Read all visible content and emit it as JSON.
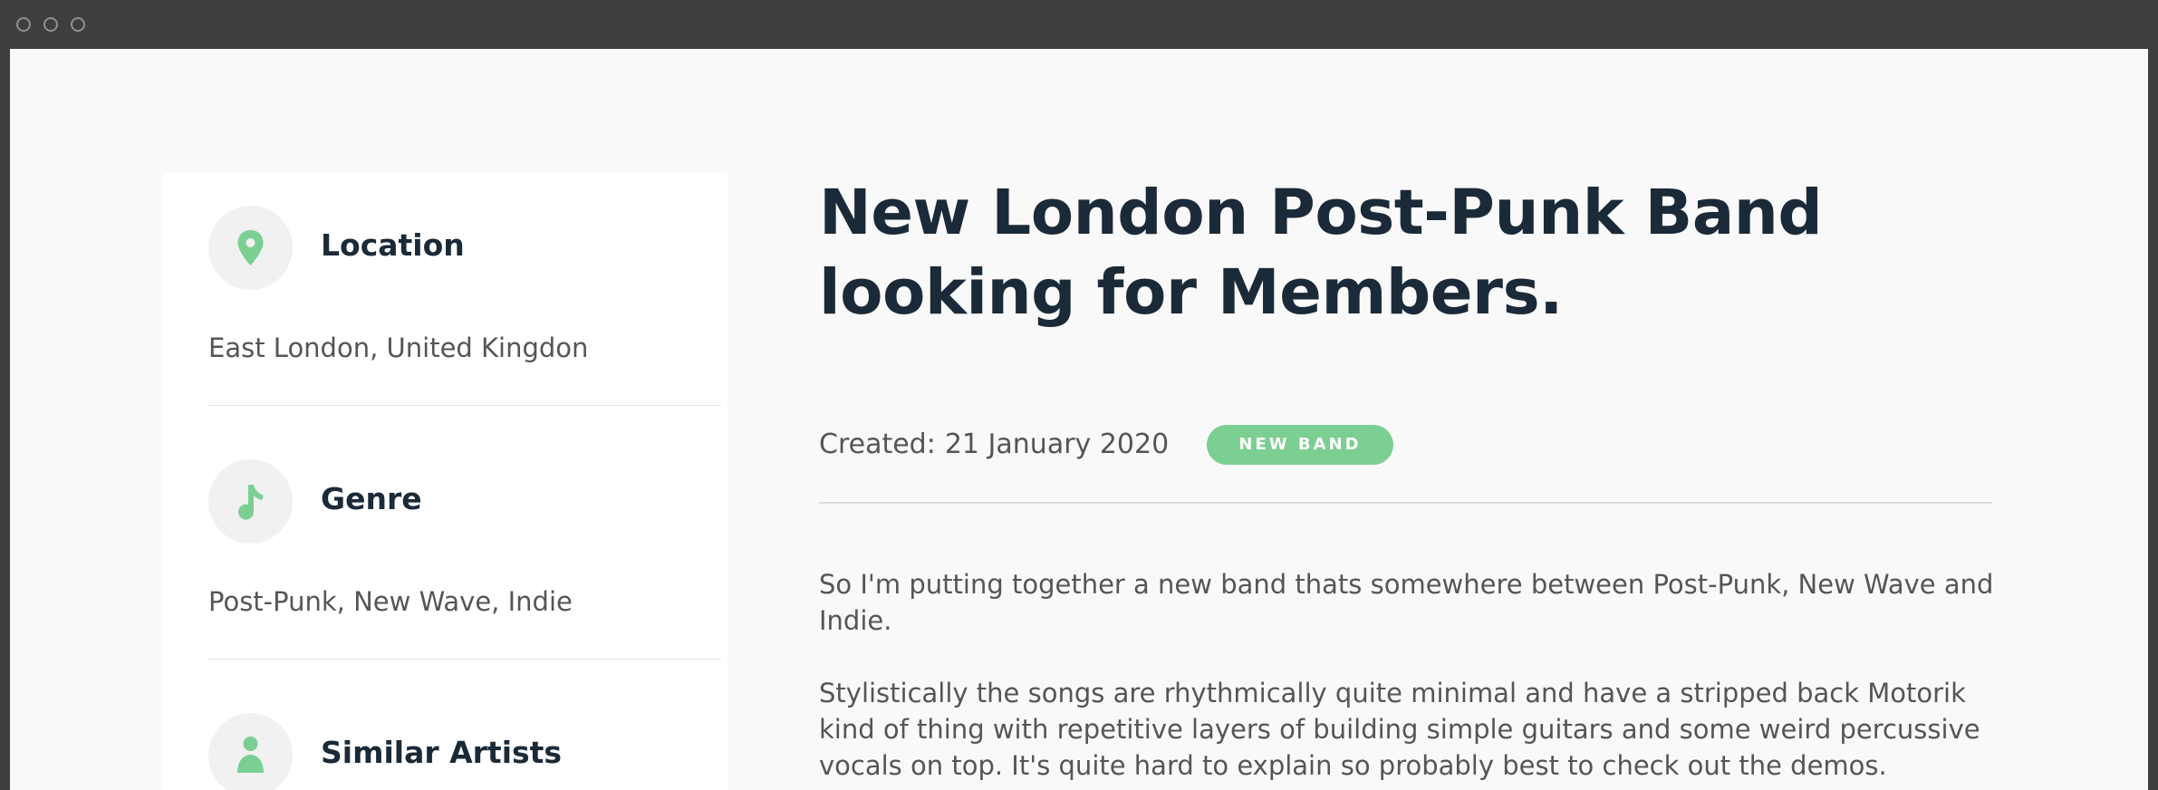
{
  "sidebar": {
    "items": [
      {
        "icon": "location-pin-icon",
        "title": "Location",
        "value": "East London, United Kingdon"
      },
      {
        "icon": "music-note-icon",
        "title": "Genre",
        "value": "Post-Punk, New Wave, Indie"
      },
      {
        "icon": "person-icon",
        "title": "Similar Artists",
        "value": ""
      }
    ]
  },
  "main": {
    "title": "New London Post-Punk Band looking for Members.",
    "created_label": "Created:",
    "created_date": "21 January 2020",
    "badge": "NEW BAND",
    "paragraphs": [
      "So I'm putting together a new band thats somewhere between Post-Punk, New Wave and Indie.",
      "Stylistically the songs are rhythmically quite minimal and have a stripped back Motorik kind of thing with repetitive layers of building simple guitars and some weird percussive vocals on top. It's quite hard to explain so probably best to check out the demos."
    ]
  },
  "colors": {
    "accent": "#7ccf93",
    "heading": "#1b2a38",
    "body_text": "#555555",
    "window_chrome": "#3e3e3e",
    "page_bg": "#f9f9f9"
  }
}
